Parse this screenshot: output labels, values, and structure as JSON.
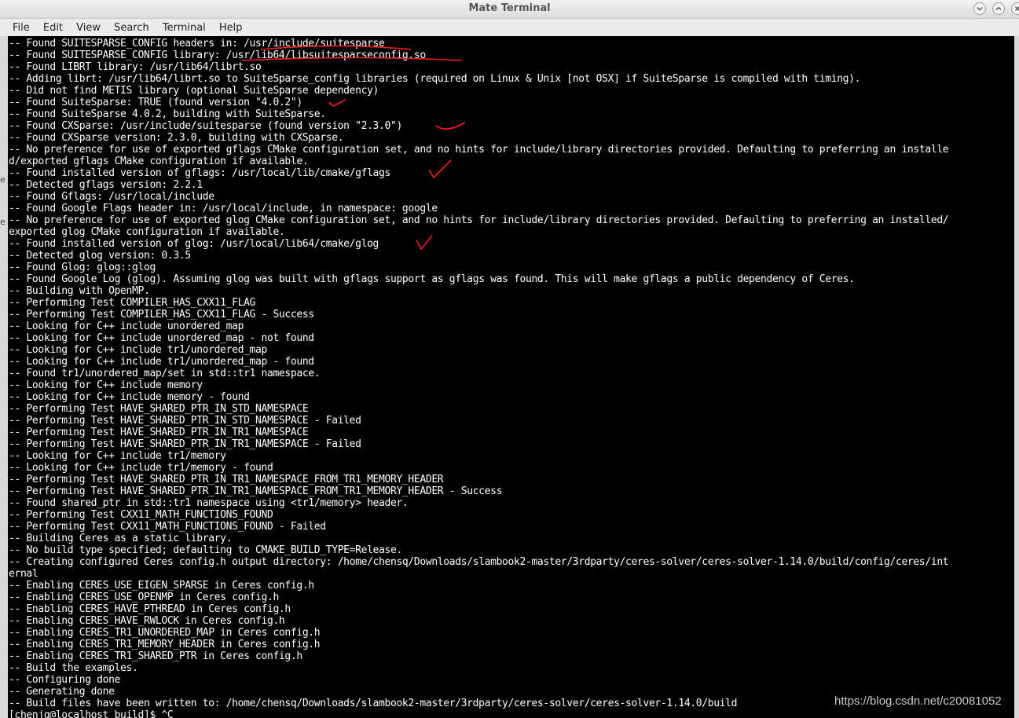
{
  "window": {
    "title": "Mate Terminal"
  },
  "menu": [
    "File",
    "Edit",
    "View",
    "Search",
    "Terminal",
    "Help"
  ],
  "left_strip_glyphs": [
    "e",
    "e"
  ],
  "terminal": {
    "lines": [
      "-- Found SUITESPARSE_CONFIG headers in: /usr/include/suitesparse",
      "-- Found SUITESPARSE_CONFIG library: /usr/lib64/libsuitesparseconfig.so",
      "-- Found LIBRT library: /usr/lib64/librt.so",
      "-- Adding librt: /usr/lib64/librt.so to SuiteSparse_config libraries (required on Linux & Unix [not OSX] if SuiteSparse is compiled with timing).",
      "-- Did not find METIS library (optional SuiteSparse dependency)",
      "-- Found SuiteSparse: TRUE (found version \"4.0.2\")",
      "-- Found SuiteSparse 4.0.2, building with SuiteSparse.",
      "-- Found CXSparse: /usr/include/suitesparse (found version \"2.3.0\")",
      "-- Found CXSparse version: 2.3.0, building with CXSparse.",
      "-- No preference for use of exported gflags CMake configuration set, and no hints for include/library directories provided. Defaulting to preferring an installe",
      "d/exported gflags CMake configuration if available.",
      "-- Found installed version of gflags: /usr/local/lib/cmake/gflags",
      "-- Detected gflags version: 2.2.1",
      "-- Found Gflags: /usr/local/include",
      "-- Found Google Flags header in: /usr/local/include, in namespace: google",
      "-- No preference for use of exported glog CMake configuration set, and no hints for include/library directories provided. Defaulting to preferring an installed/",
      "exported glog CMake configuration if available.",
      "-- Found installed version of glog: /usr/local/lib64/cmake/glog",
      "-- Detected glog version: 0.3.5",
      "-- Found Glog: glog::glog",
      "-- Found Google Log (glog). Assuming glog was built with gflags support as gflags was found. This will make gflags a public dependency of Ceres.",
      "-- Building with OpenMP.",
      "-- Performing Test COMPILER_HAS_CXX11_FLAG",
      "-- Performing Test COMPILER_HAS_CXX11_FLAG - Success",
      "-- Looking for C++ include unordered_map",
      "-- Looking for C++ include unordered_map - not found",
      "-- Looking for C++ include tr1/unordered_map",
      "-- Looking for C++ include tr1/unordered_map - found",
      "-- Found tr1/unordered_map/set in std::tr1 namespace.",
      "-- Looking for C++ include memory",
      "-- Looking for C++ include memory - found",
      "-- Performing Test HAVE_SHARED_PTR_IN_STD_NAMESPACE",
      "-- Performing Test HAVE_SHARED_PTR_IN_STD_NAMESPACE - Failed",
      "-- Performing Test HAVE_SHARED_PTR_IN_TR1_NAMESPACE",
      "-- Performing Test HAVE_SHARED_PTR_IN_TR1_NAMESPACE - Failed",
      "-- Looking for C++ include tr1/memory",
      "-- Looking for C++ include tr1/memory - found",
      "-- Performing Test HAVE_SHARED_PTR_IN_TR1_NAMESPACE_FROM_TR1_MEMORY_HEADER",
      "-- Performing Test HAVE_SHARED_PTR_IN_TR1_NAMESPACE_FROM_TR1_MEMORY_HEADER - Success",
      "-- Found shared_ptr in std::tr1 namespace using <tr1/memory> header.",
      "-- Performing Test CXX11_MATH_FUNCTIONS_FOUND",
      "-- Performing Test CXX11_MATH_FUNCTIONS_FOUND - Failed",
      "-- Building Ceres as a static library.",
      "-- No build type specified; defaulting to CMAKE_BUILD_TYPE=Release.",
      "-- Creating configured Ceres config.h output directory: /home/chensq/Downloads/slambook2-master/3rdparty/ceres-solver/ceres-solver-1.14.0/build/config/ceres/int",
      "ernal",
      "-- Enabling CERES_USE_EIGEN_SPARSE in Ceres config.h",
      "-- Enabling CERES_USE_OPENMP in Ceres config.h",
      "-- Enabling CERES_HAVE_PTHREAD in Ceres config.h",
      "-- Enabling CERES_HAVE_RWLOCK in Ceres config.h",
      "-- Enabling CERES_TR1_UNORDERED_MAP in Ceres config.h",
      "-- Enabling CERES_TR1_MEMORY_HEADER in Ceres config.h",
      "-- Enabling CERES_TR1_SHARED_PTR in Ceres config.h",
      "-- Build the examples.",
      "-- Configuring done",
      "-- Generating done",
      "-- Build files have been written to: /home/chensq/Downloads/slambook2-master/3rdparty/ceres-solver/ceres-solver-1.14.0/build",
      "[chenjq@localhost build]$ ^C"
    ],
    "text_color": "#ffffff",
    "background": "#000000",
    "annotation_color": "#ff1a1a"
  },
  "watermark": "https://blog.csdn.net/c20081052"
}
